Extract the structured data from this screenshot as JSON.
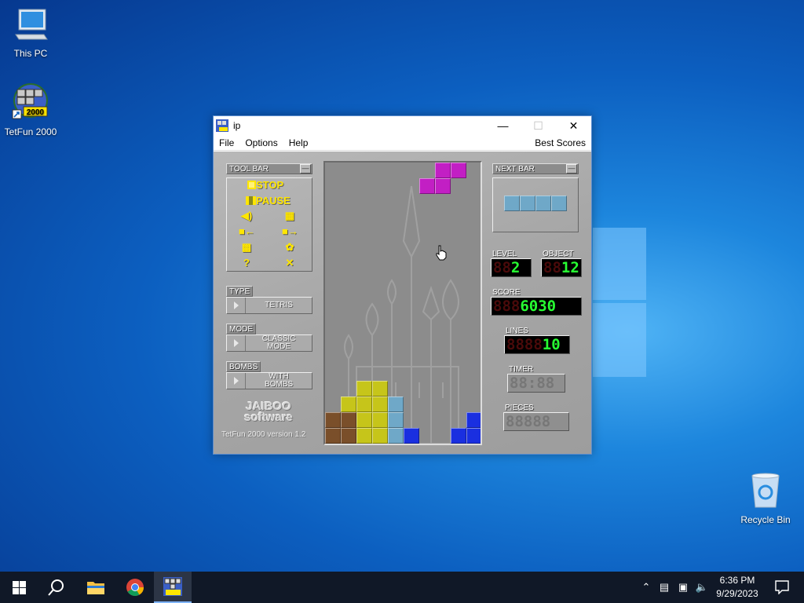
{
  "desktop": {
    "icons": [
      {
        "label": "This PC"
      },
      {
        "label": "TetFun 2000"
      },
      {
        "label": "Recycle Bin"
      }
    ]
  },
  "window": {
    "title": "ip",
    "menu": [
      "File",
      "Options",
      "Help"
    ],
    "menu_right": "Best Scores"
  },
  "toolbar_panel": {
    "caption": "TOOL BAR",
    "stop_label": "STOP",
    "pause_label": "PAUSE",
    "tool_icons": [
      "sound-icon",
      "bricks-icon",
      "save-game-icon",
      "load-game-icon",
      "print-icon",
      "hint-icon",
      "help-icon",
      "exit-icon"
    ]
  },
  "options": {
    "type_caption": "TYPE",
    "type_value": "TETRIS",
    "mode_caption": "MODE",
    "mode_value": "CLASSIC MODE",
    "bombs_caption": "BOMBS",
    "bombs_value": "WITH BOMBS"
  },
  "branding": {
    "logo_line1": "JAIBOO",
    "logo_line2": "software",
    "version": "TetFun 2000 version 1.2"
  },
  "next_bar": {
    "caption": "NEXT BAR",
    "piece_color": "#6fa8c8"
  },
  "stats": {
    "level_label": "LEVEL",
    "level_off": "88",
    "level_on": "2",
    "object_label": "OBJECT",
    "object_off": "88",
    "object_on": "12",
    "score_label": "SCORE",
    "score_off": "888",
    "score_on": "6030",
    "lines_label": "LINES",
    "lines_off": "8888",
    "lines_on": "10",
    "timer_label": "TIMER",
    "timer_display": "88:88",
    "pieces_label": "PIECES",
    "pieces_display": "88888"
  },
  "colors": {
    "magenta": "#c21fc4",
    "yellow": "#c6c51a",
    "cyan": "#6fa8c8",
    "blue": "#1a2fe0",
    "brown": "#7a4f2a"
  },
  "taskbar": {
    "time": "6:36 PM",
    "date": "9/29/2023"
  }
}
